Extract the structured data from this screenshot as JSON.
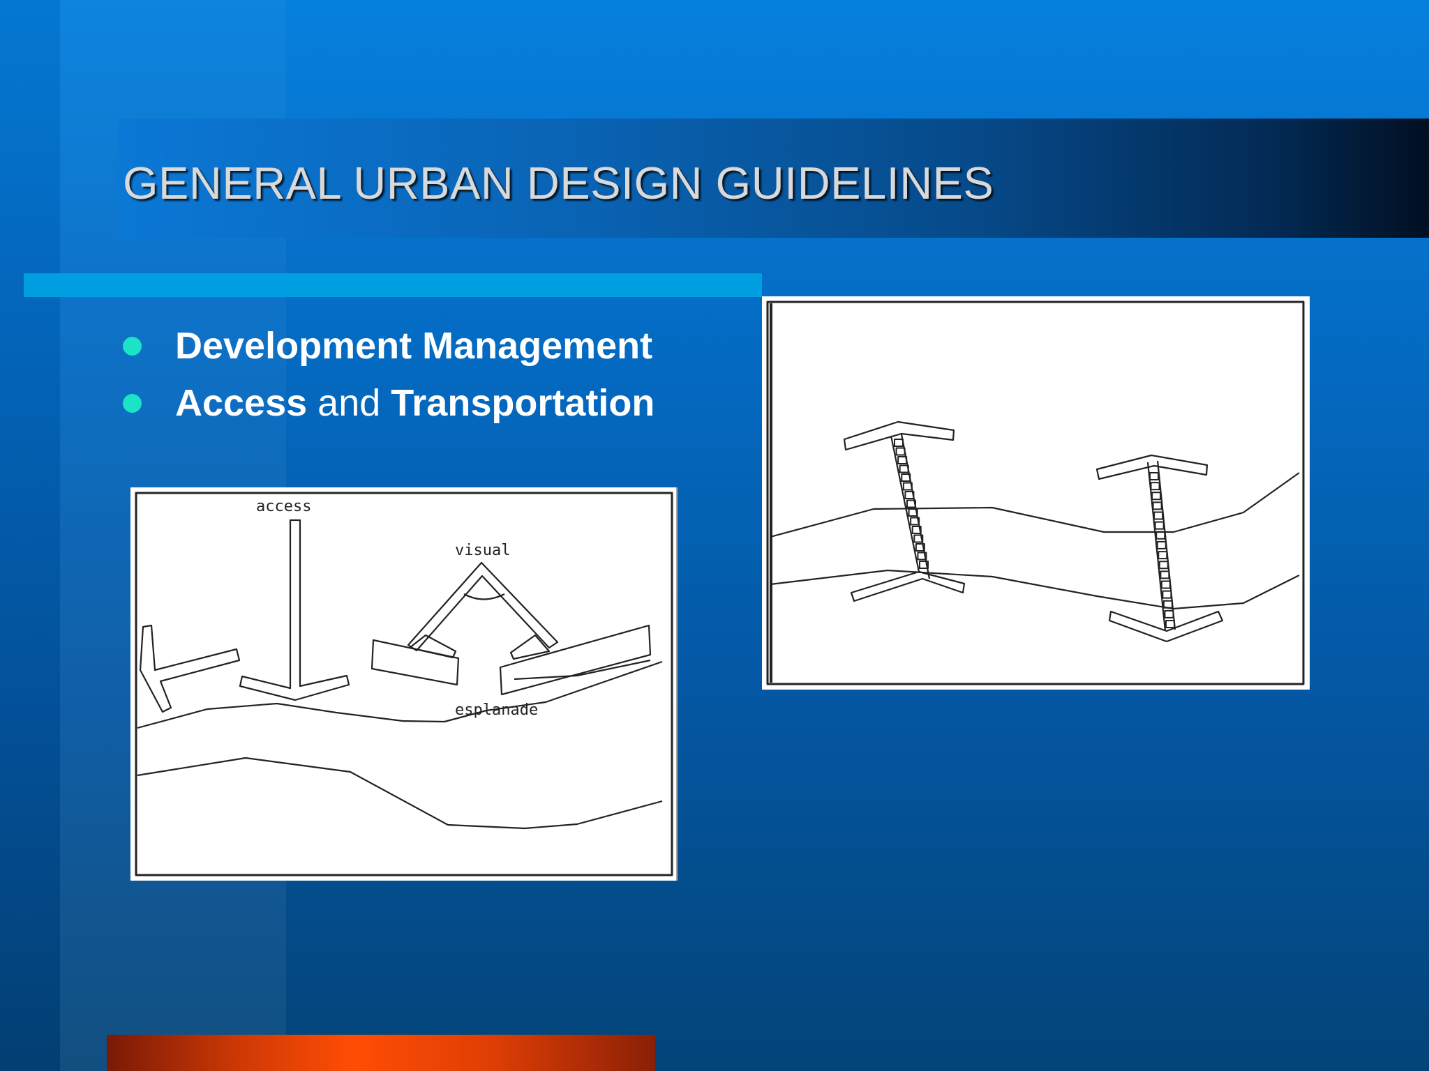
{
  "slide": {
    "title": "GENERAL URBAN DESIGN GUIDELINES",
    "bullets": [
      {
        "text": "Development Management"
      },
      {
        "parts": [
          "Access",
          " and ",
          "Transportation"
        ]
      }
    ]
  },
  "figure_left": {
    "labels": {
      "access": "access",
      "visual": "visual",
      "esplanade": "esplanade"
    }
  },
  "colors": {
    "bullet_dot": "#1ae3c6",
    "accent_bar": "#009fe2",
    "bottom_bar": "#ff4d05"
  }
}
